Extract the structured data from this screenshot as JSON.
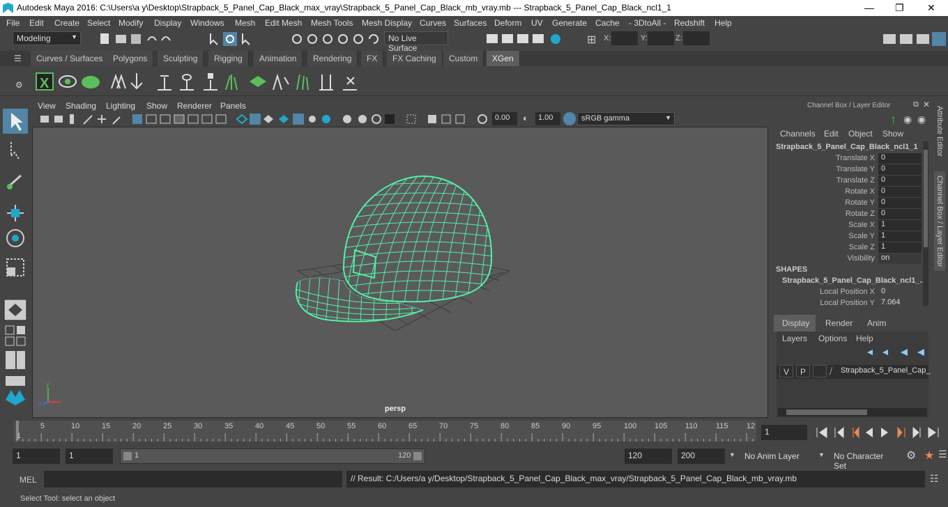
{
  "title": "Autodesk Maya 2016: C:\\Users\\a y\\Desktop\\Strapback_5_Panel_Cap_Black_max_vray\\Strapback_5_Panel_Cap_Black_mb_vray.mb   ---   Strapback_5_Panel_Cap_Black_ncl1_1",
  "menus": [
    "File",
    "Edit",
    "Create",
    "Select",
    "Modify",
    "Display",
    "Windows",
    "Mesh",
    "Edit Mesh",
    "Mesh Tools",
    "Mesh Display",
    "Curves",
    "Surfaces",
    "Deform",
    "UV",
    "Generate",
    "Cache",
    "- 3DtoAll -",
    "Redshift",
    "Help"
  ],
  "status": {
    "mode": "Modeling",
    "live_surface": "No Live Surface",
    "x_label": "X:",
    "y_label": "Y:",
    "z_label": "Z:"
  },
  "shelf_tabs": [
    "Curves / Surfaces",
    "Polygons",
    "Sculpting",
    "Rigging",
    "Animation",
    "Rendering",
    "FX",
    "FX Caching",
    "Custom",
    "XGen"
  ],
  "active_shelf": "XGen",
  "viewport_menu": [
    "View",
    "Shading",
    "Lighting",
    "Show",
    "Renderer",
    "Panels"
  ],
  "viewport_toolbar": {
    "exposure": "0.00",
    "gamma": "1.00",
    "colorspace": "sRGB gamma"
  },
  "camera_label": "persp",
  "channel_box": {
    "header": "Channel Box / Layer Editor",
    "menus": [
      "Channels",
      "Edit",
      "Object",
      "Show"
    ],
    "object": "Strapback_5_Panel_Cap_Black_ncl1_1",
    "attrs": [
      {
        "label": "Translate X",
        "value": "0"
      },
      {
        "label": "Translate Y",
        "value": "0"
      },
      {
        "label": "Translate Z",
        "value": "0"
      },
      {
        "label": "Rotate X",
        "value": "0"
      },
      {
        "label": "Rotate Y",
        "value": "0"
      },
      {
        "label": "Rotate Z",
        "value": "0"
      },
      {
        "label": "Scale X",
        "value": "1"
      },
      {
        "label": "Scale Y",
        "value": "1"
      },
      {
        "label": "Scale Z",
        "value": "1"
      },
      {
        "label": "Visibility",
        "value": "on"
      }
    ],
    "shapes_header": "SHAPES",
    "shape_name": "Strapback_5_Panel_Cap_Black_ncl1_...",
    "shape_attrs": [
      {
        "label": "Local Position X",
        "value": "0"
      },
      {
        "label": "Local Position Y",
        "value": "7.064"
      }
    ]
  },
  "layer_editor": {
    "tabs": [
      "Display",
      "Render",
      "Anim"
    ],
    "menus": [
      "Layers",
      "Options",
      "Help"
    ],
    "layer": {
      "v": "V",
      "p": "P",
      "name": "Strapback_5_Panel_Cap_"
    }
  },
  "side_tabs": [
    "Attribute Editor",
    "Channel Box / Layer Editor"
  ],
  "timeline": {
    "ticks": [
      "5",
      "10",
      "15",
      "20",
      "25",
      "30",
      "35",
      "40",
      "45",
      "50",
      "55",
      "60",
      "65",
      "70",
      "75",
      "80",
      "85",
      "90",
      "95",
      "100",
      "105",
      "110",
      "115",
      "12"
    ],
    "current_frame": "1",
    "start_marker": "1"
  },
  "range": {
    "start": "1",
    "start2": "1",
    "slider_start": "1",
    "slider_end": "120",
    "end": "120",
    "end2": "200",
    "anim_layer": "No Anim Layer",
    "char_set": "No Character Set"
  },
  "cmd": {
    "label": "MEL",
    "result": "// Result: C:/Users/a y/Desktop/Strapback_5_Panel_Cap_Black_max_vray/Strapback_5_Panel_Cap_Black_mb_vray.mb"
  },
  "help_line": "Select Tool: select an object",
  "colors": {
    "wire": "#54f0a6",
    "accent": "#5285a6"
  }
}
